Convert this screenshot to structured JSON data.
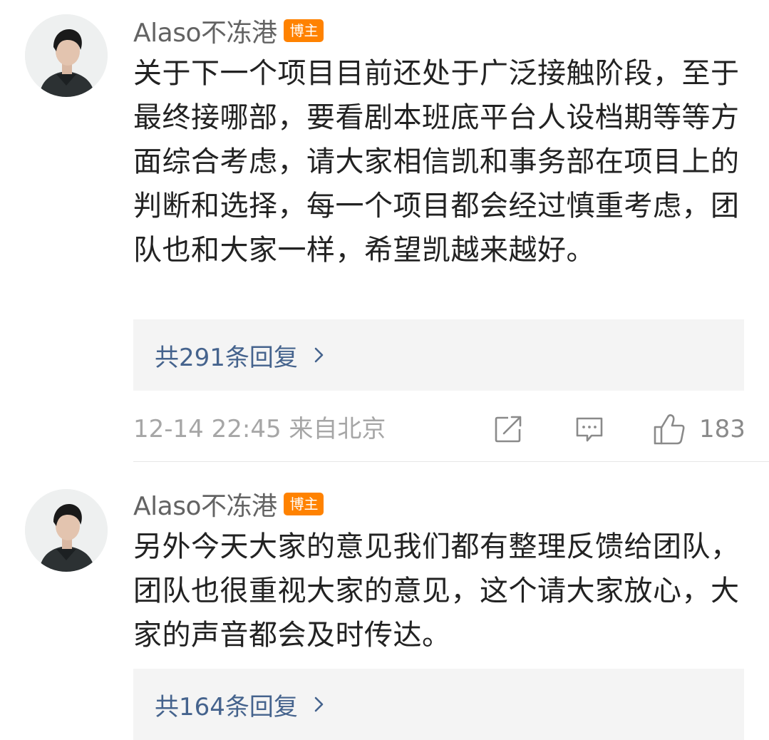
{
  "comments": [
    {
      "username": "Alaso不冻港",
      "badge": "博主",
      "text": "关于下一个项目目前还处于广泛接触阶段，至于最终接哪部，要看剧本班底平台人设档期等等方面综合考虑，请大家相信凯和事务部在项目上的判断和选择，每一个项目都会经过慎重考虑，团队也和大家一样，希望凯越来越好。",
      "replies_label": "共291条回复",
      "time_location": "12-14 22:45  来自北京",
      "like_count": "183"
    },
    {
      "username": "Alaso不冻港",
      "badge": "博主",
      "text": "另外今天大家的意见我们都有整理反馈给团队，团队也很重视大家的意见，这个请大家放心，大家的声音都会及时传达。",
      "replies_label": "共164条回复"
    }
  ],
  "icons": {
    "avatar": "avatar-image",
    "share": "share-icon",
    "reply": "comment-icon",
    "like": "thumbs-up-icon",
    "chevron": "chevron-right-icon"
  },
  "colors": {
    "badge": "#ff8200",
    "link": "#45638d",
    "meta": "#a6a6a6",
    "reply_box_bg": "#f4f4f4"
  }
}
